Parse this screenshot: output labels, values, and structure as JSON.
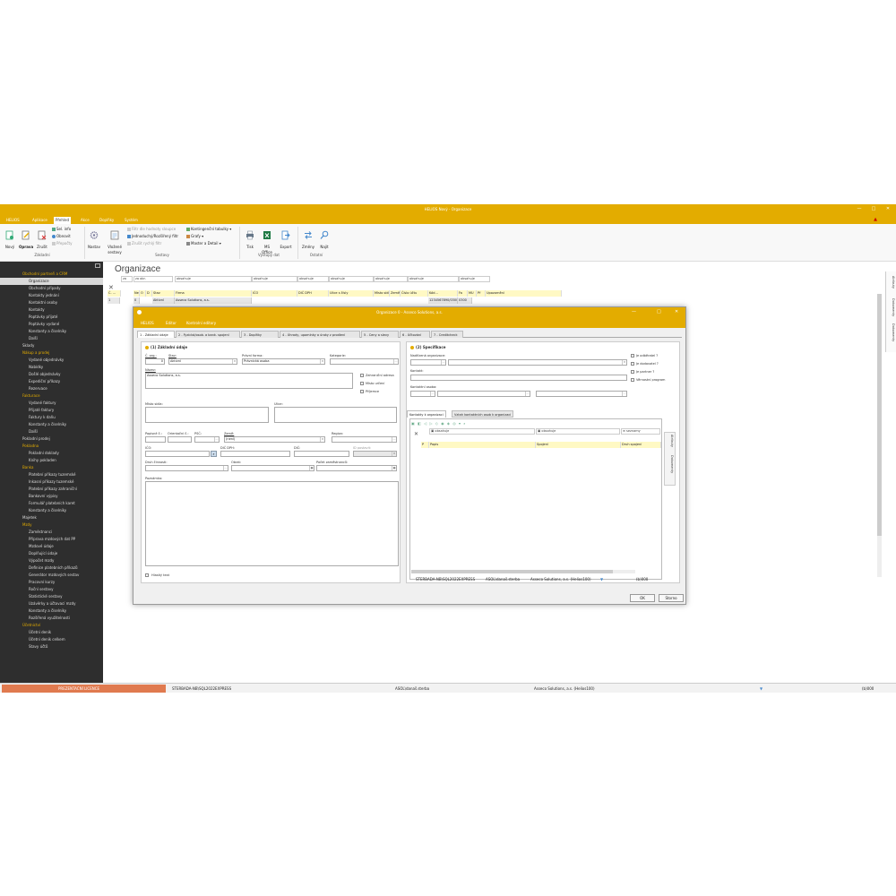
{
  "window": {
    "title": "HELIOS Nový - Organizace"
  },
  "menu": {
    "app": "HELIOS",
    "tabs": [
      "Aplikace",
      "Přehled",
      "Akce",
      "Doplňky",
      "Systém"
    ]
  },
  "ribbon": {
    "zaklad": {
      "novy": "Nový",
      "oprava": "Oprava",
      "zrusit": "Zrušit",
      "sel_info": "Sel. info",
      "obnovit": "Obnovit",
      "prepocty": "Přepočty",
      "group": "Základní"
    },
    "sestavy": {
      "nastav": "Nastav",
      "vlozene": "Vložené",
      "vlozene2": "sestavy",
      "filtr_dle": "Filtr dle hodnoty sloupce",
      "jednoduchy": "Jednoduchý/Rozšířený filtr",
      "zrusit_filtr": "Zrušit rychlý filtr",
      "kontingencni": "Kontingenční tabulky",
      "grafy": "Grafy",
      "master": "Master a Detail",
      "group": "Sestavy"
    },
    "vystupy": {
      "tisk": "Tisk",
      "ms_office": "MS",
      "ms_office2": "Office",
      "export": "Export",
      "group": "Výstupy dat"
    },
    "ostatni": {
      "zmeny": "Změny",
      "najit": "Najít",
      "group": "Ostatní"
    }
  },
  "sidebar": {
    "items": [
      {
        "label": "Obchodní partneři a CRM",
        "type": "sec"
      },
      {
        "label": "Organizace",
        "type": "sel"
      },
      {
        "label": "Obchodní případy",
        "type": "item"
      },
      {
        "label": "Kontakty jednání",
        "type": "item"
      },
      {
        "label": "Kontaktní osoby",
        "type": "item"
      },
      {
        "label": "Kontakty",
        "type": "item"
      },
      {
        "label": "Poptávky přijaté",
        "type": "item"
      },
      {
        "label": "Poptávky vydané",
        "type": "item"
      },
      {
        "label": "Konstanty a číselníky",
        "type": "item"
      },
      {
        "label": "Další",
        "type": "item"
      },
      {
        "label": "Sklady",
        "type": "top"
      },
      {
        "label": "Nákup a prodej",
        "type": "sec"
      },
      {
        "label": "Vydané objednávky",
        "type": "item"
      },
      {
        "label": "Nabídky",
        "type": "item"
      },
      {
        "label": "Došlé objednávky",
        "type": "item"
      },
      {
        "label": "Expediční příkazy",
        "type": "item"
      },
      {
        "label": "Rezervace",
        "type": "item"
      },
      {
        "label": "Fakturace",
        "type": "sec"
      },
      {
        "label": "Vydané faktury",
        "type": "item"
      },
      {
        "label": "Přijaté faktury",
        "type": "item"
      },
      {
        "label": "Faktury k daňu",
        "type": "item"
      },
      {
        "label": "Konstanty a číselníky",
        "type": "item"
      },
      {
        "label": "Další",
        "type": "item"
      },
      {
        "label": "Pokladní prodej",
        "type": "top"
      },
      {
        "label": "Pokladna",
        "type": "sec"
      },
      {
        "label": "Pokladní doklady",
        "type": "item"
      },
      {
        "label": "Knihy pokladen",
        "type": "item"
      },
      {
        "label": "Banka",
        "type": "sec"
      },
      {
        "label": "Platební příkazy tuzemské",
        "type": "item"
      },
      {
        "label": "Inkasní příkazy tuzemské",
        "type": "item"
      },
      {
        "label": "Platební příkazy zahraniční",
        "type": "item"
      },
      {
        "label": "Bankovní výpisy",
        "type": "item"
      },
      {
        "label": "Formulář platebních karet",
        "type": "item"
      },
      {
        "label": "Konstanty a číselníky",
        "type": "item"
      },
      {
        "label": "Majetek",
        "type": "top"
      },
      {
        "label": "Mzdy",
        "type": "sec"
      },
      {
        "label": "Zaměstnanci",
        "type": "item"
      },
      {
        "label": "Příprava mzdových dat PP",
        "type": "item"
      },
      {
        "label": "Mzdové údaje",
        "type": "item"
      },
      {
        "label": "Doplňující údaje",
        "type": "item"
      },
      {
        "label": "Výpočet mzdy",
        "type": "item"
      },
      {
        "label": "Definice platebních příkazů",
        "type": "item"
      },
      {
        "label": "Generátor mzdových sestav",
        "type": "item"
      },
      {
        "label": "Pracovní kurzy",
        "type": "item"
      },
      {
        "label": "Roční sestavy",
        "type": "item"
      },
      {
        "label": "Statistické sestavy",
        "type": "item"
      },
      {
        "label": "Uzávěrky a účtovací mzdy",
        "type": "item"
      },
      {
        "label": "Konstanty a číselníky",
        "type": "item"
      },
      {
        "label": "Rozšířená využitelnosti",
        "type": "item"
      },
      {
        "label": "Účetnictví",
        "type": "sec"
      },
      {
        "label": "Účetní deník",
        "type": "item"
      },
      {
        "label": "Účetní deník celkem",
        "type": "item"
      },
      {
        "label": "Stavy účtů",
        "type": "item"
      }
    ]
  },
  "main": {
    "title": "Organizace",
    "filters": [
      "za obr.",
      "za obr.",
      "obsahuje",
      "obsahuje",
      "obsahuje",
      "obsahuje",
      "obsahuje",
      "obsahuje",
      "obsahuje"
    ],
    "headers": [
      "Č. ...",
      "Ne",
      "O",
      "D",
      "Stav",
      "Firma",
      "IČO",
      "DIČ DPH",
      "Ulice s čísly",
      "Místo sídla",
      "Země",
      "Číslo účtu",
      "Kód...",
      "Fa",
      "MU",
      "Př",
      "Upozornění"
    ],
    "row": {
      "num": "1",
      "n": "0",
      "stav": "Aktivní",
      "firma": "Asseco Solutions, a.s.",
      "ucet": "1234567890/0300",
      "kod": "0300"
    }
  },
  "rightpanel": {
    "tabs": [
      "Atributy",
      "Dokumenty",
      "Dokumenty"
    ]
  },
  "status": {
    "items": [
      "PREZENTAČNÍ LICENCE",
      "STERBADA-NB\\SQL2022EXPRESS",
      "ASOL\\današ.sterba",
      "Asseco Solutions, a.s. (Helios100)",
      "(b)000"
    ]
  },
  "dialog": {
    "title": "Organizace 0 - Asseco Solutions, a.s.",
    "menu": [
      "HELIOS",
      "Editor",
      "Kontrolní editory"
    ],
    "tabs": [
      "1 - Základní údaje",
      "2 - Fyzická/osob. a bank. spojení",
      "3 - Doplňky",
      "4 - Úhrady, upomínky a úroky z prodlení",
      "5 - Ceny a slevy",
      "6 - Účtování",
      "7 - Creditcheck"
    ],
    "left": {
      "section": "(1) Základní údaje",
      "cislo_lbl": "Č. org.:",
      "cislo_val": "0",
      "stav_lbl": "Stav:",
      "stav_val": "Aktivní",
      "pravni_lbl": "Právní forma:",
      "pravni_val": "Právnická osoba",
      "kategorie_lbl": "Kategorie:",
      "nazev_lbl": "Název:",
      "nazev_val": "Asseco Solutions, a.s.",
      "chk": [
        "Zahraniční adresa",
        "Místo určení",
        "Příjemce"
      ],
      "misto_lbl": "Místo sídla:",
      "ulice_lbl": "Ulice:",
      "popisne_lbl": "Popisné č.:",
      "orient_lbl": "Orientační č.:",
      "psc_lbl": "PSČ:",
      "zeme_lbl": "Země:",
      "zeme_val": "(není)",
      "region_lbl": "Region:",
      "ico_lbl": "IČO:",
      "dicdph_lbl": "DIČ DPH:",
      "dic_lbl": "DIČ:",
      "dic_postavit": "ID postavit:",
      "druh_lbl": "Druh činnosti:",
      "obrat_lbl": "Obrat:",
      "pocet_lbl": "Počet zaměstnanců:",
      "pozn_lbl": "Poznámka:",
      "hlasit": "Hlasitý text"
    },
    "right": {
      "section": "(2) Specifikace",
      "nadrizena_lbl": "Nadřízená organizace:",
      "kontakt_lbl": "Kontakt:",
      "kontaktni_lbl": "Kontaktní osoba:",
      "chk": [
        "Je odběratel ?",
        "Je dodavatel ?",
        "Je partner ?",
        "Věrnostní program"
      ],
      "subtabs": [
        "Kontakty k organizaci",
        "Vztah kontaktních osob k organizaci"
      ],
      "grid_filters": [
        "obsahuje",
        "obsahuje",
        "seznamy"
      ],
      "grid_headers": [
        "P",
        "Popis",
        "Spojení",
        "Druh spojení"
      ],
      "side_tabs": [
        "Atributy",
        "Dokumenty"
      ]
    },
    "status": [
      "STERBADA-NB\\SQL2022EXPRESS",
      "ASOL\\današ.sterba",
      "Asseco Solutions, a.s. (Helios100)",
      "(b)000"
    ],
    "ok": "OK",
    "storno": "Storno"
  },
  "colors": {
    "accent": "#e3ac00",
    "sidebar": "#2e2e2e",
    "license": "#e07a4f"
  }
}
